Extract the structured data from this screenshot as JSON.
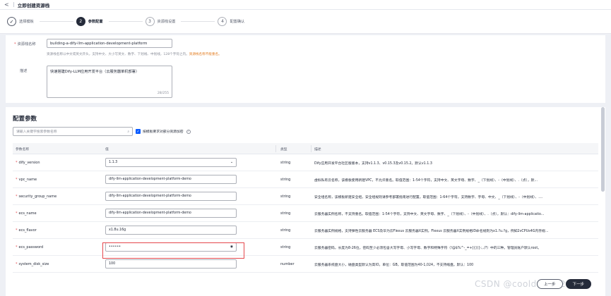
{
  "header": {
    "back_glyph": "<",
    "title": "立即创建资源栈"
  },
  "steps": [
    {
      "num": "✓",
      "label": "选择模板",
      "state": "done"
    },
    {
      "num": "2",
      "label": "参数配置",
      "state": "active"
    },
    {
      "num": "3",
      "label": "资源栈设置",
      "state": "pending"
    },
    {
      "num": "4",
      "label": "配置确认",
      "state": "pending"
    }
  ],
  "basic": {
    "name_label": "资源栈名称",
    "name_value": "building-a-dify-llm-application-development-platform",
    "name_hint": "资源栈名称以中文或英文开头，支持中文、大小写英文、数字、下划线、中划线，128个字符之内。",
    "name_warn": "资源栈名称不能重名。",
    "desc_label": "描述",
    "desc_value": "快速搭建Dify-LLM应用开发平台（云服务器单机部署）",
    "desc_count": "28/255"
  },
  "params": {
    "title": "配置参数",
    "search_placeholder": "请输入关键字搜索参数名称",
    "checkbox_label": "按模板要求对部分资源加密",
    "columns": [
      "参数名称",
      "值",
      "类型",
      "描述"
    ],
    "rows": [
      {
        "name": "dify_version",
        "value": "1.1.3",
        "has_dropdown": true,
        "type": "string",
        "desc": "Dify应用开发平台社区版版本，支持v1.1.3、v0.15.3及v0.15.2。默认v1.1.3"
      },
      {
        "name": "vpc_name",
        "value": "dify-llm-application-development-platform-demo",
        "type": "string",
        "desc": "虚拟私有云名称，该模板使用新建VPC，不允许重名。取值范围：1-54个字符，支持中文、英文字母、数字、_（下划线）、-（中划线）、.（点），默..."
      },
      {
        "name": "security_group_name",
        "value": "dify-llm-application-development-platform-demo",
        "type": "string",
        "desc": "安全组名称，该模板新建安全组，安全组规则请参考部署指南进行配置。取值范围：1-64个字符，支持数字、字母、中文、_（下划线）、-（中划线）、...."
      },
      {
        "name": "ecs_name",
        "value": "dify-llm-application-development-platform-demo",
        "type": "string",
        "desc": "云服务器实例名称，不支持重名。取值范围：1-54个字符，支持中文、英文字母、数字、_（下划线）、-（中划线）、.（点），默认：dify-llm-applicatio..."
      },
      {
        "name": "ecs_flavor",
        "value": "x1.8u.16g",
        "type": "string",
        "desc": "云服务器实例规格，支持弹性云服务器 ECS及华为云Flexus 云服务器X实例。Flexus 云服务器X实例规格ID命名规则为x1.?u.?g，例如2vCPUs4G内存规..."
      },
      {
        "name": "ecs_password",
        "value": "••••••",
        "has_eye": true,
        "type": "string",
        "desc": "云服务器密码，长度为8-26位，密码至少必须包含大写字母、小写字母、数字和特殊字符（!@$%^-_=+[{()}:,./?）中的三种。管理员账户默认root。"
      },
      {
        "name": "system_disk_size",
        "value": "100",
        "type": "number",
        "desc": "云服务器系统盘大小，磁盘类型默认为高IO，单位：GB，取值范围为40-1,024，不支持缩盘。默认：100"
      }
    ]
  },
  "footer": {
    "prev_label": "上一步",
    "next_label": "下一步"
  },
  "watermark": "CSDN @cooldream2009",
  "icons": {
    "search": "search-icon",
    "eye": "eye-icon",
    "dropdown": "chevron-down-icon",
    "help": "help-icon"
  }
}
